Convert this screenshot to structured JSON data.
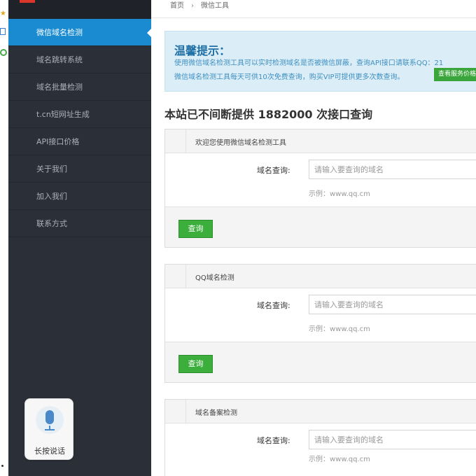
{
  "sidebar": {
    "items": [
      {
        "label": "微信域名检测",
        "active": true
      },
      {
        "label": "域名跳转系统",
        "active": false
      },
      {
        "label": "域名批量检测",
        "active": false
      },
      {
        "label": "t.cn短网址生成",
        "active": false
      },
      {
        "label": "API接口价格",
        "active": false
      },
      {
        "label": "关于我们",
        "active": false
      },
      {
        "label": "加入我们",
        "active": false
      },
      {
        "label": "联系方式",
        "active": false
      }
    ]
  },
  "voice": {
    "label": "长按说话",
    "icon": "microphone-icon"
  },
  "breadcrumb": {
    "home": "首页",
    "separator": "›",
    "current": "微信工具"
  },
  "notice": {
    "title": "温馨提示：",
    "line1": "使用微信域名检测工具可以实时检测域名是否被微信屏蔽，查询API接口请联系QQ：21",
    "line2": "微信域名检测工具每天可供10次免费查询，购买VIP可提供更多次数查询。",
    "button": "查看服务价格"
  },
  "headline": "本站已不间断提供 1882000 次接口查询",
  "panels": [
    {
      "title": "欢迎您使用微信域名检测工具",
      "field_label": "域名查询:",
      "placeholder": "请输入要查询的域名",
      "hint": "示例：www.qq.cm",
      "button": "查询"
    },
    {
      "title": "QQ域名检测",
      "field_label": "域名查询:",
      "placeholder": "请输入要查询的域名",
      "hint": "示例：www.qq.cm",
      "button": "查询"
    },
    {
      "title": "域名备案检测",
      "field_label": "域名查询:",
      "placeholder": "请输入要查询的域名",
      "hint": "示例：www.qq.cm"
    }
  ],
  "colors": {
    "sidebar_bg": "#2b3038",
    "active": "#1a8bd0",
    "notice_bg": "#dbeef8",
    "button_green": "#3bae3b"
  }
}
